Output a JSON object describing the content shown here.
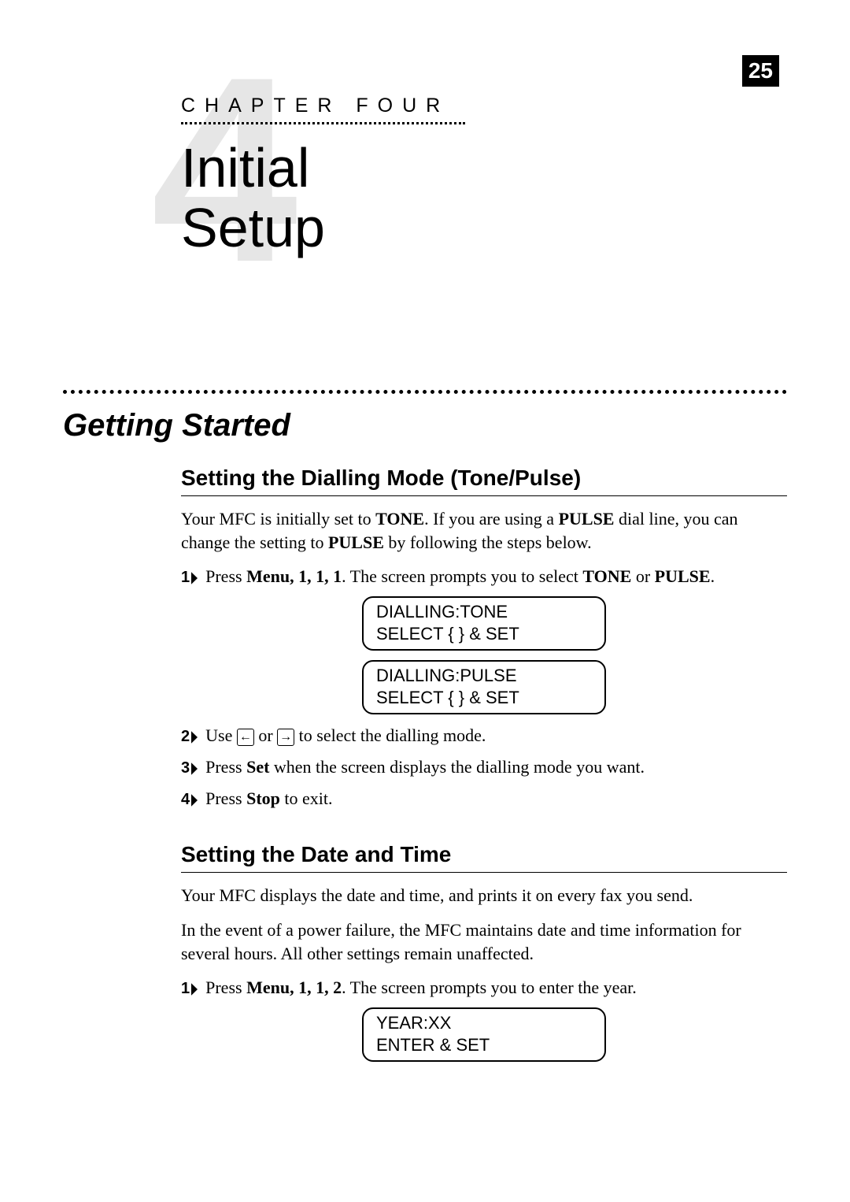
{
  "page_number": "25",
  "chapter": {
    "big_number": "4",
    "label": "CHAPTER FOUR",
    "title_line1": "Initial",
    "title_line2": "Setup"
  },
  "section_heading": "Getting Started",
  "sub1": {
    "heading": "Setting the Dialling Mode (Tone/Pulse)",
    "intro_pre": "Your MFC is initially set to ",
    "intro_b1": "TONE",
    "intro_mid": ". If you are using a ",
    "intro_b2": "PULSE",
    "intro_post": " dial line, you can change the setting to ",
    "intro_b3": "PULSE",
    "intro_tail": " by following the steps below.",
    "step1_pre": "Press ",
    "step1_menu": "Menu",
    "step1_keys": ", 1, 1, 1",
    "step1_mid": ". The screen prompts you to select ",
    "step1_tone": "TONE",
    "step1_or": " or ",
    "step1_pulse": "PULSE",
    "step1_end": ".",
    "lcd1_l1": "DIALLING:TONE",
    "lcd1_l2": "SELECT { } & SET",
    "lcd2_l1": "DIALLING:PULSE",
    "lcd2_l2": "SELECT { } & SET",
    "step2_pre": "Use ",
    "step2_or": " or ",
    "step2_post": " to select the dialling mode.",
    "step3_pre": "Press ",
    "step3_set": "Set",
    "step3_post": " when the screen displays the dialling mode you want.",
    "step4_pre": "Press ",
    "step4_stop": "Stop",
    "step4_post": " to exit."
  },
  "sub2": {
    "heading": "Setting the Date and Time",
    "para1": "Your MFC displays the date and time, and prints it on every fax you send.",
    "para2": "In the event of a power failure, the MFC maintains date and time information for several hours. All other settings remain unaffected.",
    "step1_pre": "Press ",
    "step1_menu": "Menu",
    "step1_keys": ", 1, 1, 2",
    "step1_post": ". The screen prompts you to enter the year.",
    "lcd1_l1": "YEAR:XX",
    "lcd1_l2": "ENTER & SET"
  },
  "arrows": {
    "left": "←",
    "right": "→"
  }
}
